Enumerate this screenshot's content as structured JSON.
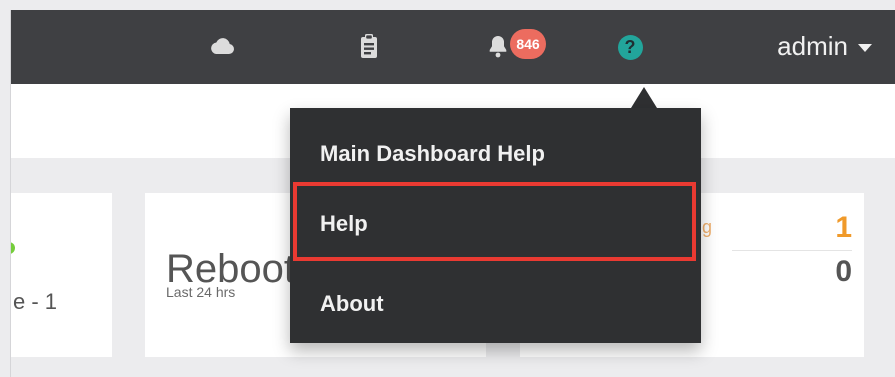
{
  "topbar": {
    "notification_count": "846",
    "help_symbol": "?",
    "user_label": "admin",
    "icons": {
      "cloud": "cloud-icon",
      "clipboard": "clipboard-icon",
      "notifications": "bell-icon",
      "help": "help-icon",
      "dropdown": "chevron-down-icon"
    }
  },
  "cards": {
    "left_partial": "e - 1",
    "reboot": {
      "title": "Reboot",
      "subtitle": "Last 24 hrs"
    },
    "right_partial": {
      "orange_partial_text": "g",
      "value_top": "1",
      "value_bottom": "0"
    }
  },
  "dropdown": {
    "items": [
      {
        "label": "Main Dashboard Help"
      },
      {
        "label": "Help"
      },
      {
        "label": "About"
      }
    ]
  },
  "colors": {
    "topbar_bg": "#3f4043",
    "menu_bg": "#2f3032",
    "accent_teal": "#22a59b",
    "badge_red": "#ec6c5f",
    "highlight_red": "#ea3a32",
    "stat_orange": "#f09a2a"
  }
}
